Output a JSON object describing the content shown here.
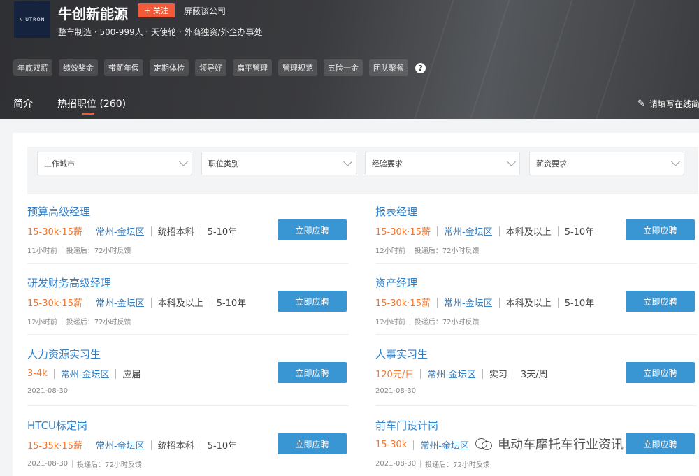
{
  "company": {
    "logo_text": "NIUTRON",
    "name": "牛创新能源",
    "follow_label": "+ 关注",
    "block_label": "屏蔽该公司",
    "meta": "整车制造 · 500-999人 · 天使轮 · 外商独资/外企办事处",
    "tags": [
      "年底双薪",
      "绩效奖金",
      "带薪年假",
      "定期体检",
      "领导好",
      "扁平管理",
      "管理规范",
      "五险一金",
      "团队聚餐"
    ],
    "help_icon": "?"
  },
  "tabs": {
    "intro": "简介",
    "hot_jobs": "热招职位 (260)"
  },
  "resume_link": "请填写在线简",
  "filters": [
    {
      "placeholder": "工作城市"
    },
    {
      "placeholder": "职位类别"
    },
    {
      "placeholder": "经验要求"
    },
    {
      "placeholder": "薪资要求"
    }
  ],
  "apply_label": "立即应聘",
  "jobs": [
    {
      "title": "预算高级经理",
      "salary": "15-30k·15薪",
      "location": "常州-金坛区",
      "education": "统招本科",
      "experience": "5-10年",
      "time": "11小时前",
      "feedback": "投递后：72小时反馈"
    },
    {
      "title": "报表经理",
      "salary": "15-30k·15薪",
      "location": "常州-金坛区",
      "education": "本科及以上",
      "experience": "5-10年",
      "time": "12小时前",
      "feedback": "投递后：72小时反馈"
    },
    {
      "title": "研发财务高级经理",
      "salary": "15-30k·15薪",
      "location": "常州-金坛区",
      "education": "本科及以上",
      "experience": "5-10年",
      "time": "12小时前",
      "feedback": "投递后：72小时反馈"
    },
    {
      "title": "资产经理",
      "salary": "15-30k·15薪",
      "location": "常州-金坛区",
      "education": "本科及以上",
      "experience": "5-10年",
      "time": "12小时前",
      "feedback": "投递后：72小时反馈"
    },
    {
      "title": "人力资源实习生",
      "salary": "3-4k",
      "location": "常州-金坛区",
      "education": "应届",
      "experience": "",
      "time": "2021-08-30",
      "feedback": ""
    },
    {
      "title": "人事实习生",
      "salary": "120元/日",
      "location": "常州-金坛区",
      "education": "实习",
      "experience": "3天/周",
      "time": "2021-08-30",
      "feedback": ""
    },
    {
      "title": "HTCU标定岗",
      "salary": "15-35k·15薪",
      "location": "常州-金坛区",
      "education": "统招本科",
      "experience": "5-10年",
      "time": "2021-08-30",
      "feedback": "投递后：72小时反馈"
    },
    {
      "title": "前车门设计岗",
      "salary": "15-30k",
      "location": "常州-金坛区",
      "education": "",
      "experience": "",
      "time": "2021-08-30",
      "feedback": "投递后：72小时反馈"
    }
  ],
  "watermark": "电动车摩托车行业资讯"
}
